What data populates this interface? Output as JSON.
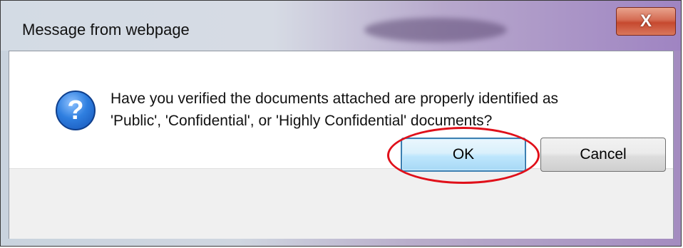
{
  "dialog": {
    "title": "Message from webpage",
    "close_label": "X",
    "message_line1": "Have you verified the documents attached are properly identified as",
    "message_line2": "'Public', 'Confidential', or 'Highly Confidential' documents?",
    "icon": "question-icon",
    "ok_label": "OK",
    "cancel_label": "Cancel"
  },
  "colors": {
    "annotation": "#e0101a",
    "ok_border": "#3c7fb1",
    "close_button": "#c6492f"
  }
}
